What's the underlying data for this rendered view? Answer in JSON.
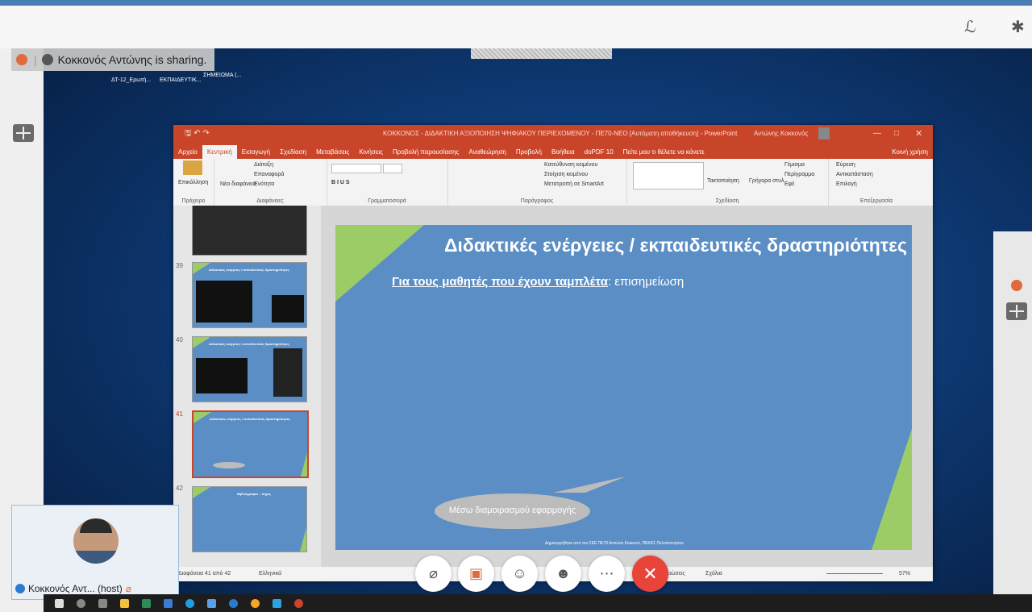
{
  "top_bar": {
    "icons": [
      "scribble-icon",
      "bluetooth-icon"
    ]
  },
  "share_banner": {
    "text": "Κοκκονός Αντώνης is sharing."
  },
  "desktop_icons": {
    "label1": "ΔΤ-12_Ερωτή...",
    "label2": "ΕΚΠΑΙΔΕΥΤΙΚ...",
    "label3": "ΣΗΜΕΙΩΜΑ (..."
  },
  "ppt": {
    "window_title": "ΚΟΚΚΟΝΟΣ - ΔΙΔΑΚΤΙΚΗ ΑΞΙΟΠΟΙΗΣΗ ΨΗΦΙΑΚΟΥ ΠΕΡΙΕΧΟΜΕΝΟΥ - ΠΕ70-ΝΕΟ [Αυτόματη αποθήκευση] - PowerPoint",
    "user_name": "Αντώνης Κοκκονός",
    "tabs": [
      "Αρχείο",
      "Κεντρική",
      "Εισαγωγή",
      "Σχεδίαση",
      "Μεταβάσεις",
      "Κινήσεις",
      "Προβολή παρουσίασης",
      "Αναθεώρηση",
      "Προβολή",
      "Βοήθεια",
      "doPDF 10",
      "Πείτε μου τι θέλετε να κάνετε"
    ],
    "share_label": "Κοινή χρήση",
    "ribbon": {
      "paste": "Επικόλληση",
      "clipboard": "Πρόχειρο",
      "new_slide": "Νέα διαφάνεια",
      "layout": "Διάταξη",
      "reset": "Επαναφορά",
      "section": "Ενότητα",
      "slides": "Διαφάνειες",
      "font": "Γραμματοσειρά",
      "paragraph": "Παράγραφος",
      "text_direction": "Κατεύθυνση κειμένου",
      "align_text": "Στοίχιση κειμένου",
      "smartart": "Μετατροπή σε SmartArt",
      "arrange": "Τακτοποίηση",
      "quick_styles": "Γρήγορα στυλ",
      "shape_fill": "Γέμισμα",
      "shape_outline": "Περίγραμμα",
      "effects": "Εφέ",
      "drawing": "Σχεδίαση",
      "find": "Εύρεση",
      "replace": "Αντικατάσταση",
      "select": "Επιλογή",
      "editing": "Επεξεργασία"
    },
    "thumbnails": [
      {
        "num": "39",
        "title": "Διδακτικές ενέργειες / εκπαιδευτικές δραστηριότητες"
      },
      {
        "num": "40",
        "title": "Διδακτικές ενέργειες / εκπαιδευτικές δραστηριότητες"
      },
      {
        "num": "41",
        "title": "Διδακτικές ενέργειες / εκπαιδευτικές δραστηριότητες"
      },
      {
        "num": "42",
        "title": "Βιβλιογραφία – πηγές"
      }
    ],
    "slide": {
      "title": "Διδακτικές ενέργειες / εκπαιδευτικές δραστηριότητες",
      "subtitle_bold": "Για τους μαθητές που έχουν ταμπλέτα",
      "subtitle_rest": ": επισημείωση",
      "bubble": "Μέσω διαμοιρασμού εφαρμογής",
      "credit": "Δημιουργήθηκε από τον ΣΕΕ ΠΕ70 Αντώνιο Κοκκονό, ΠΕΚΕΣ Πελοποννήσου"
    },
    "status": {
      "slide_counter": "Διαφάνεια 41 από 42",
      "language": "Ελληνικά",
      "notes": "Σημειώσεις",
      "comments": "Σχόλια",
      "zoom": "57%"
    }
  },
  "self_view": {
    "name": "Κοκκονός Αντ... (host)"
  },
  "controls": [
    "mute-mic-icon",
    "stop-video-icon",
    "participants-icon",
    "reactions-icon",
    "more-icon",
    "end-call-icon"
  ],
  "colors": {
    "ppt_accent": "#c9452a",
    "slide_bg": "#5b8ec5",
    "slide_green": "#9ccc65",
    "end_call": "#e8443a"
  }
}
